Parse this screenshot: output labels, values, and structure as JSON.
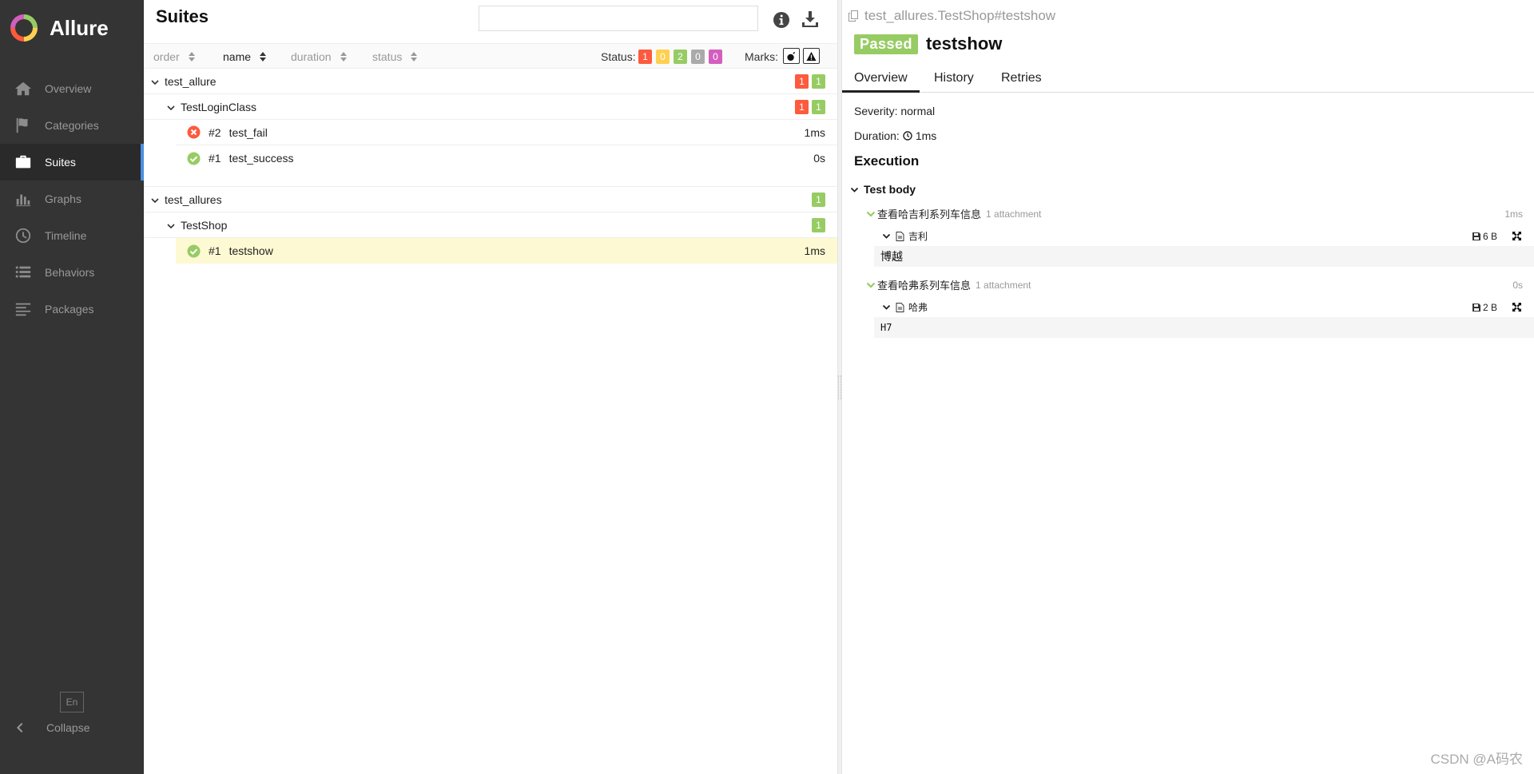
{
  "app": {
    "brand": "Allure"
  },
  "sidebar": {
    "items": [
      {
        "label": "Overview",
        "icon": "home-icon"
      },
      {
        "label": "Categories",
        "icon": "flag-icon"
      },
      {
        "label": "Suites",
        "icon": "briefcase-icon",
        "active": true
      },
      {
        "label": "Graphs",
        "icon": "bar-chart-icon"
      },
      {
        "label": "Timeline",
        "icon": "clock-icon"
      },
      {
        "label": "Behaviors",
        "icon": "list-icon"
      },
      {
        "label": "Packages",
        "icon": "align-left-icon"
      }
    ],
    "lang": "En",
    "collapse": "Collapse"
  },
  "suites": {
    "title": "Suites",
    "sort": {
      "order": "order",
      "name": "name",
      "duration": "duration",
      "status": "status"
    },
    "status_label": "Status:",
    "status_counts": {
      "failed": "1",
      "broken": "0",
      "passed": "2",
      "skipped": "0",
      "unknown": "0"
    },
    "marks_label": "Marks:",
    "groups": [
      {
        "name": "test_allure",
        "badges": [
          "1",
          "1"
        ],
        "classes": [
          {
            "name": "TestLoginClass",
            "badges": [
              "1",
              "1"
            ],
            "cases": [
              {
                "num": "#2",
                "name": "test_fail",
                "duration": "1ms",
                "status": "failed"
              },
              {
                "num": "#1",
                "name": "test_success",
                "duration": "0s",
                "status": "passed"
              }
            ]
          }
        ]
      },
      {
        "name": "test_allures",
        "badges": [
          "1"
        ],
        "classes": [
          {
            "name": "TestShop",
            "badges": [
              "1"
            ],
            "cases": [
              {
                "num": "#1",
                "name": "testshow",
                "duration": "1ms",
                "status": "passed"
              }
            ]
          }
        ]
      }
    ]
  },
  "detail": {
    "path": "test_allures.TestShop#testshow",
    "status": "Passed",
    "name": "testshow",
    "tabs": [
      "Overview",
      "History",
      "Retries"
    ],
    "severity_label": "Severity:",
    "severity": "normal",
    "duration_label": "Duration:",
    "duration": "1ms",
    "execution": "Execution",
    "test_body": "Test body",
    "steps": [
      {
        "name": "查看哈吉利系列车信息",
        "attachments": "1 attachment",
        "duration": "1ms",
        "attachment": {
          "name": "吉利",
          "size": "6 B",
          "content": "博越"
        }
      },
      {
        "name": "查看哈弗系列车信息",
        "attachments": "1 attachment",
        "duration": "0s",
        "attachment": {
          "name": "哈弗",
          "size": "2 B",
          "content": "H7"
        }
      }
    ]
  },
  "watermark": "CSDN @A码农",
  "colors": {
    "failed": "#fd5a3e",
    "broken": "#ffd050",
    "passed": "#97cc64",
    "skipped": "#aaaaaa",
    "unknown": "#d35ebe",
    "accent": "#4a90e2"
  }
}
